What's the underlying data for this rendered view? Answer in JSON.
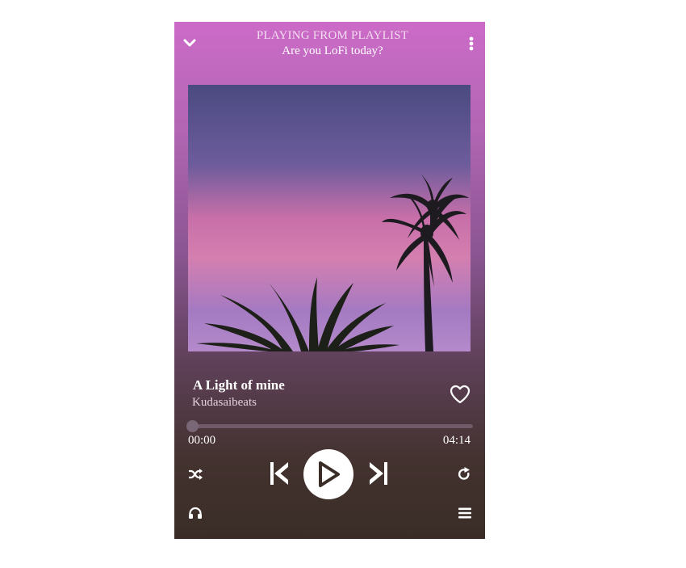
{
  "header": {
    "title": "PLAYING FROM PLAYLIST",
    "subtitle": "Are you LoFi today?"
  },
  "track": {
    "title": "A Light of mine",
    "artist": "Kudasaibeats"
  },
  "progress": {
    "current_time": "00:00",
    "duration": "04:14",
    "fraction": 0.0
  },
  "icons": {
    "collapse": "chevron-down-icon",
    "more": "vertical-dots-icon",
    "like": "heart-icon",
    "shuffle": "shuffle-icon",
    "previous": "skip-previous-icon",
    "play": "play-icon",
    "next": "skip-next-icon",
    "repeat": "repeat-icon",
    "devices": "headphones-icon",
    "queue": "queue-list-icon"
  },
  "colors": {
    "gradient_top": "#cc6bc8",
    "gradient_bottom": "#3a2d27",
    "accent": "#ffffff"
  }
}
